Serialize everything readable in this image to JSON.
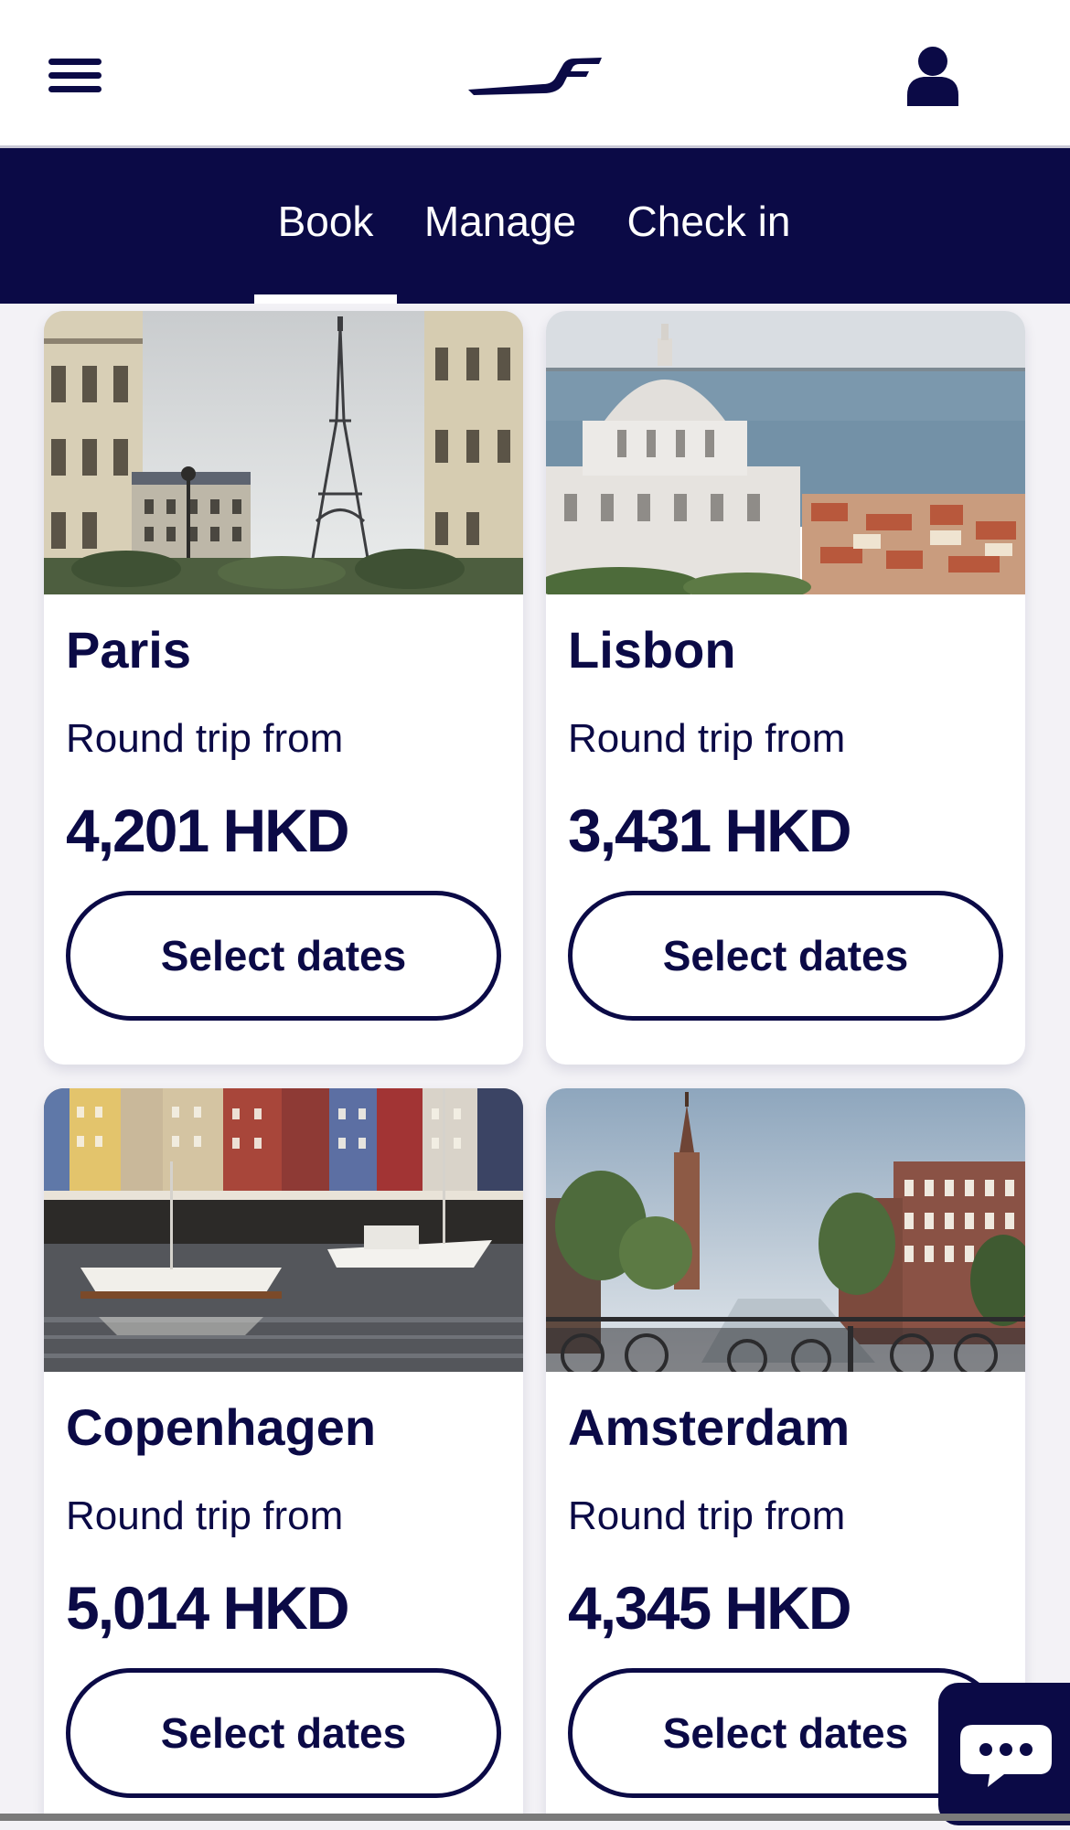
{
  "header": {
    "menu_icon": "hamburger-menu-icon",
    "logo_icon": "airline-logo-icon",
    "profile_icon": "user-profile-icon"
  },
  "tabs": [
    {
      "label": "Book",
      "active": true
    },
    {
      "label": "Manage",
      "active": false
    },
    {
      "label": "Check in",
      "active": false
    }
  ],
  "destinations": [
    {
      "city": "Paris",
      "from_label": "Round trip from",
      "price": "4,201 HKD",
      "button_label": "Select dates"
    },
    {
      "city": "Lisbon",
      "from_label": "Round trip from",
      "price": "3,431 HKD",
      "button_label": "Select dates"
    },
    {
      "city": "Copenhagen",
      "from_label": "Round trip from",
      "price": "5,014 HKD",
      "button_label": "Select dates"
    },
    {
      "city": "Amsterdam",
      "from_label": "Round trip from",
      "price": "4,345 HKD",
      "button_label": "Select dates"
    }
  ],
  "chat": {
    "icon": "chat-bubble-icon"
  },
  "colors": {
    "brand_navy": "#0b0a46",
    "background": "#f3f2f6",
    "card": "#ffffff"
  }
}
